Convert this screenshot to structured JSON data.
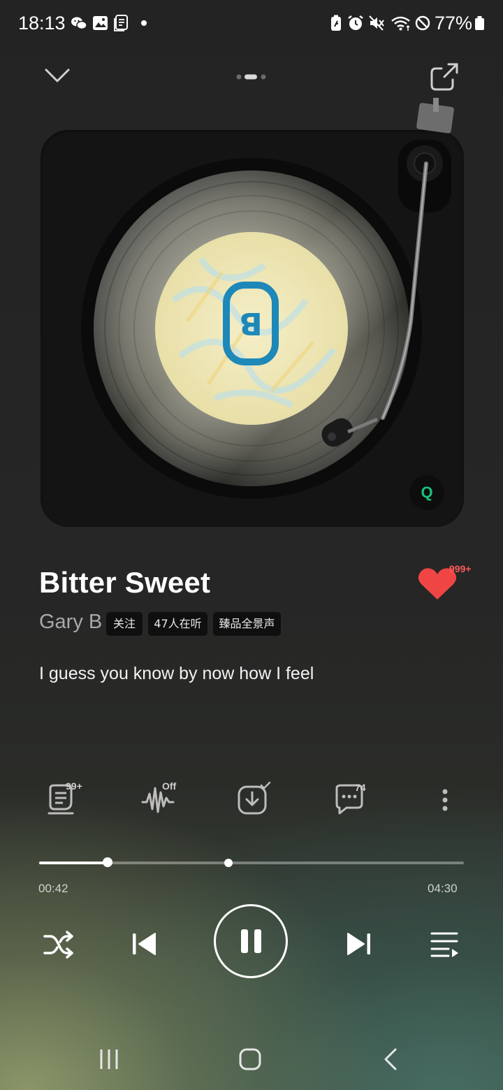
{
  "status_bar": {
    "time": "18:13",
    "battery_text": "77%",
    "left_icons": [
      "wechat-icon",
      "gallery-icon",
      "notes-icon",
      "notification-dot"
    ],
    "right_icons": [
      "battery-saver-icon",
      "alarm-icon",
      "mute-icon",
      "wifi-icon",
      "do-not-disturb-icon",
      "battery-icon"
    ]
  },
  "top_nav": {
    "collapse_icon": "chevron-down-icon",
    "share_icon": "share-icon",
    "pages": 3,
    "active_page": 2
  },
  "player": {
    "quality_badge": "Q",
    "song_title": "Bitter Sweet",
    "artist": "Gary B",
    "tags": [
      "关注",
      "47人在听",
      "臻品全景声"
    ],
    "like_count": "999+",
    "lyric": "I guess you know by now how I feel"
  },
  "actions": [
    {
      "name": "lyrics-button",
      "icon": "lyrics-icon",
      "badge": "99+"
    },
    {
      "name": "sound-effect-button",
      "icon": "waveform-icon",
      "badge": "Off"
    },
    {
      "name": "download-button",
      "icon": "download-check-icon",
      "badge": ""
    },
    {
      "name": "comments-button",
      "icon": "comment-icon",
      "badge": "74"
    },
    {
      "name": "more-button",
      "icon": "more-vertical-icon",
      "badge": ""
    }
  ],
  "progress": {
    "elapsed": "00:42",
    "total": "04:30",
    "fraction": 0.162
  },
  "controls": {
    "shuffle_icon": "shuffle-icon",
    "previous_icon": "skip-previous-icon",
    "play_pause_icon": "pause-icon",
    "next_icon": "skip-next-icon",
    "playlist_icon": "playlist-icon"
  },
  "colors": {
    "like": "#f04545",
    "quality": "#19c37d",
    "label": "#f3e9b8",
    "label_accent": "#1e88b8"
  }
}
